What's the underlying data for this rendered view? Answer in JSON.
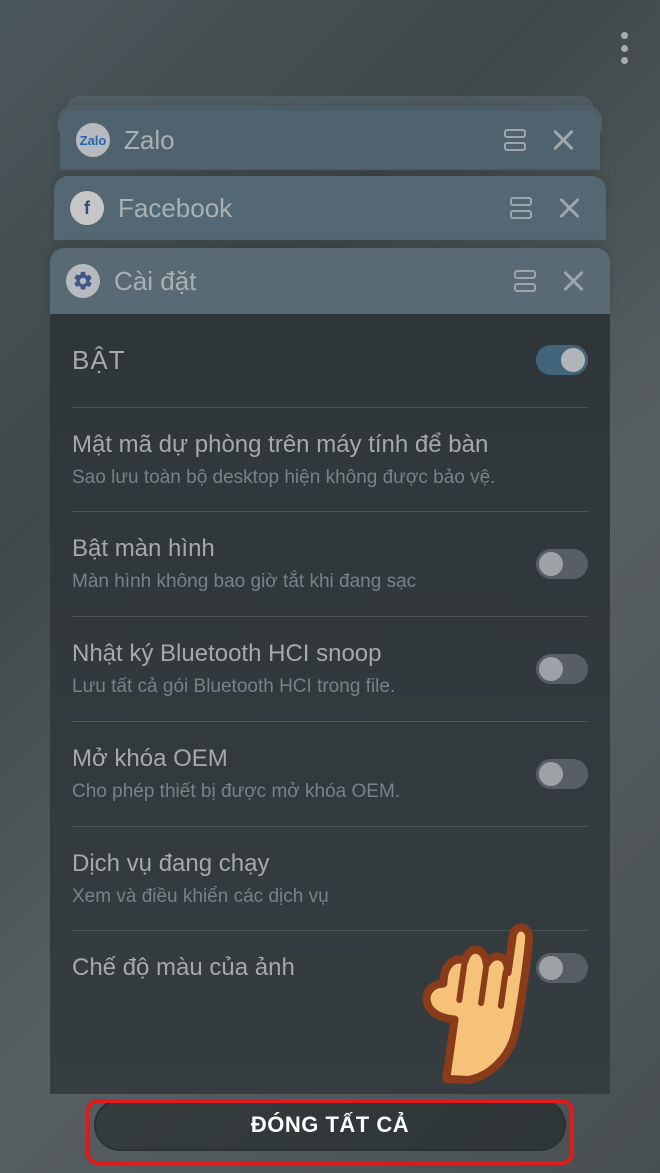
{
  "more_menu": {
    "name": "more-options"
  },
  "recent_apps": [
    {
      "id": "zalo",
      "label": "Zalo"
    },
    {
      "id": "facebook",
      "label": "Facebook"
    },
    {
      "id": "settings",
      "label": "Cài đặt"
    }
  ],
  "settings": {
    "master": {
      "label": "BẬT",
      "on": true
    },
    "items": [
      {
        "title": "Mật mã dự phòng trên máy tính để bàn",
        "sub": "Sao lưu toàn bộ desktop hiện không được bảo vệ.",
        "toggle": null
      },
      {
        "title": "Bật màn hình",
        "sub": "Màn hình không bao giờ tắt khi đang sạc",
        "toggle": false
      },
      {
        "title": "Nhật ký Bluetooth HCI snoop",
        "sub": "Lưu tất cả gói Bluetooth HCI trong file.",
        "toggle": false
      },
      {
        "title": "Mở khóa OEM",
        "sub": "Cho phép thiết bị được mở khóa OEM.",
        "toggle": false
      },
      {
        "title": "Dịch vụ đang chạy",
        "sub": "Xem và điều khiển các dịch vụ",
        "toggle": null
      },
      {
        "title": "Chế độ màu của ảnh",
        "sub": "",
        "toggle": false
      }
    ]
  },
  "close_all_label": "ĐÓNG TẤT CẢ"
}
